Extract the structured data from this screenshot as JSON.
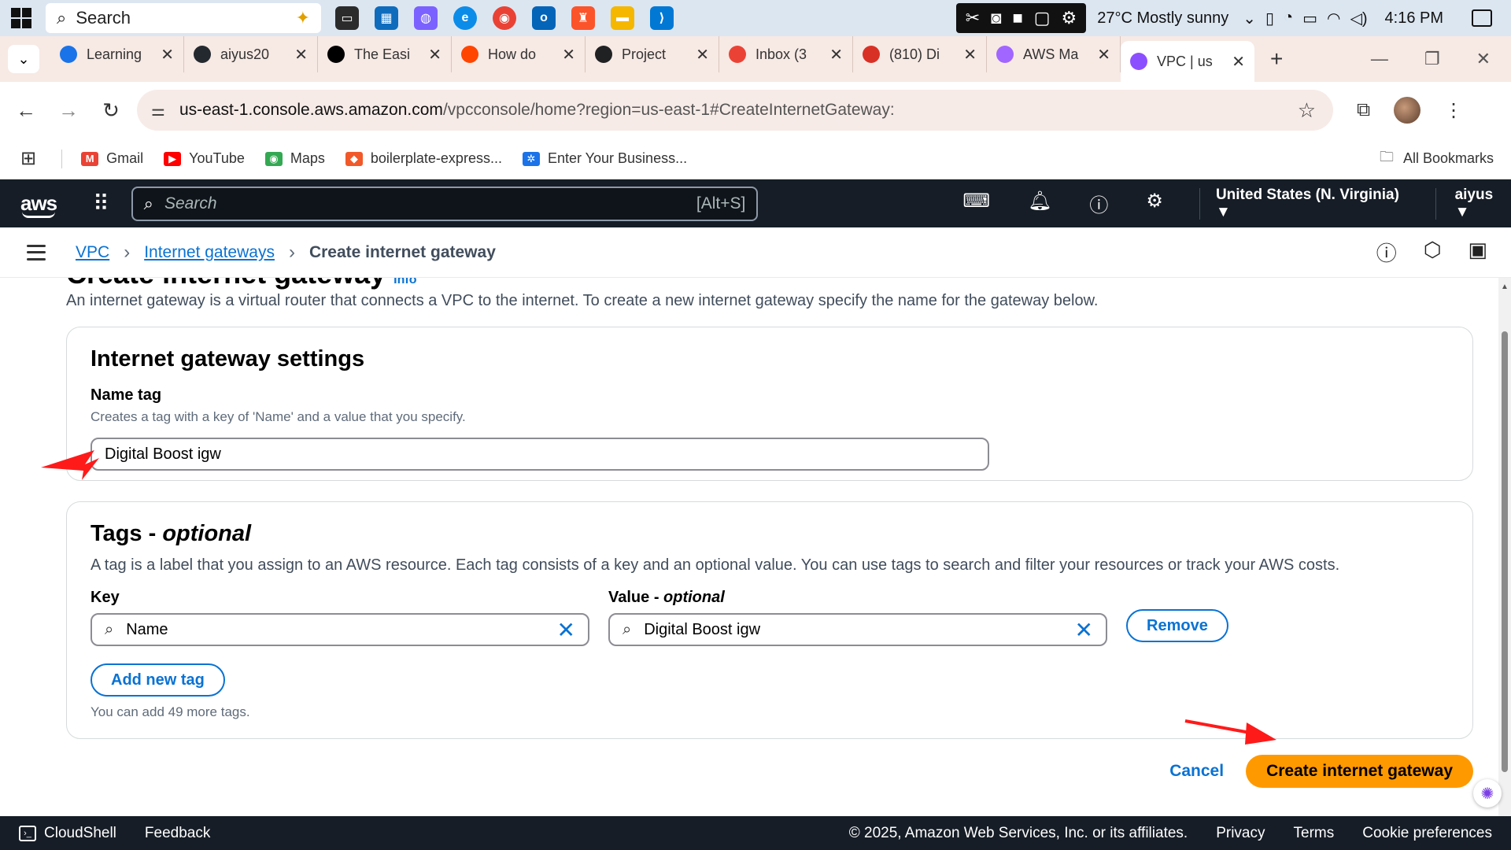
{
  "taskbar": {
    "search_placeholder": "Search",
    "weather": "27°C  Mostly sunny",
    "time": "4:16 PM"
  },
  "tabs": [
    {
      "title": "Learning",
      "color": "#1a73e8"
    },
    {
      "title": "aiyus20",
      "color": "#24292f"
    },
    {
      "title": "The Easi",
      "color": "#000000"
    },
    {
      "title": "How do",
      "color": "#ff4500"
    },
    {
      "title": "Project",
      "color": "#202123"
    },
    {
      "title": "Inbox (3",
      "color": "#ea4335"
    },
    {
      "title": "(810) Di",
      "color": "#d93025"
    },
    {
      "title": "AWS Ma",
      "color": "#a166ff"
    },
    {
      "title": "VPC | us",
      "color": "#8c4fff"
    }
  ],
  "address": {
    "host": "us-east-1.console.aws.amazon.com",
    "path": "/vpcconsole/home?region=us-east-1#CreateInternetGateway:"
  },
  "bookmarks": [
    {
      "label": "Gmail",
      "color": "#ea4335",
      "glyph": "M"
    },
    {
      "label": "YouTube",
      "color": "#ff0000",
      "glyph": "▶"
    },
    {
      "label": "Maps",
      "color": "#34a853",
      "glyph": "◉"
    },
    {
      "label": "boilerplate-express...",
      "color": "#f1592a",
      "glyph": "◆"
    },
    {
      "label": "Enter Your Business...",
      "color": "#1a73e8",
      "glyph": "✲"
    }
  ],
  "all_bookmarks": "All Bookmarks",
  "aws": {
    "search_placeholder": "Search",
    "search_shortcut": "[Alt+S]",
    "region": "United States (N. Virginia) ▼",
    "user": "aiyus ▼"
  },
  "breadcrumb": {
    "vpc": "VPC",
    "igws": "Internet gateways",
    "current": "Create internet gateway"
  },
  "page": {
    "title": "Create internet gateway",
    "info": "Info",
    "description": "An internet gateway is a virtual router that connects a VPC to the internet. To create a new internet gateway specify the name for the gateway below."
  },
  "settings": {
    "heading": "Internet gateway settings",
    "name_label": "Name tag",
    "name_hint": "Creates a tag with a key of 'Name' and a value that you specify.",
    "name_value": "Digital Boost igw"
  },
  "tags": {
    "heading": "Tags - ",
    "heading_em": "optional",
    "description": "A tag is a label that you assign to an AWS resource. Each tag consists of a key and an optional value. You can use tags to search and filter your resources or track your AWS costs.",
    "key_label": "Key",
    "value_label": "Value - ",
    "value_label_em": "optional",
    "key_value": "Name",
    "value_value": "Digital Boost igw",
    "remove": "Remove",
    "add": "Add new tag",
    "remaining": "You can add 49 more tags."
  },
  "actions": {
    "cancel": "Cancel",
    "create": "Create internet gateway"
  },
  "footer": {
    "cloudshell": "CloudShell",
    "feedback": "Feedback",
    "copyright": "© 2025, Amazon Web Services, Inc. or its affiliates.",
    "privacy": "Privacy",
    "terms": "Terms",
    "cookies": "Cookie preferences"
  },
  "colors": {
    "aws_dark": "#161d26",
    "link_blue": "#0972d3",
    "primary_orange": "#ff9900",
    "annotation_red": "#ff1a1a"
  }
}
